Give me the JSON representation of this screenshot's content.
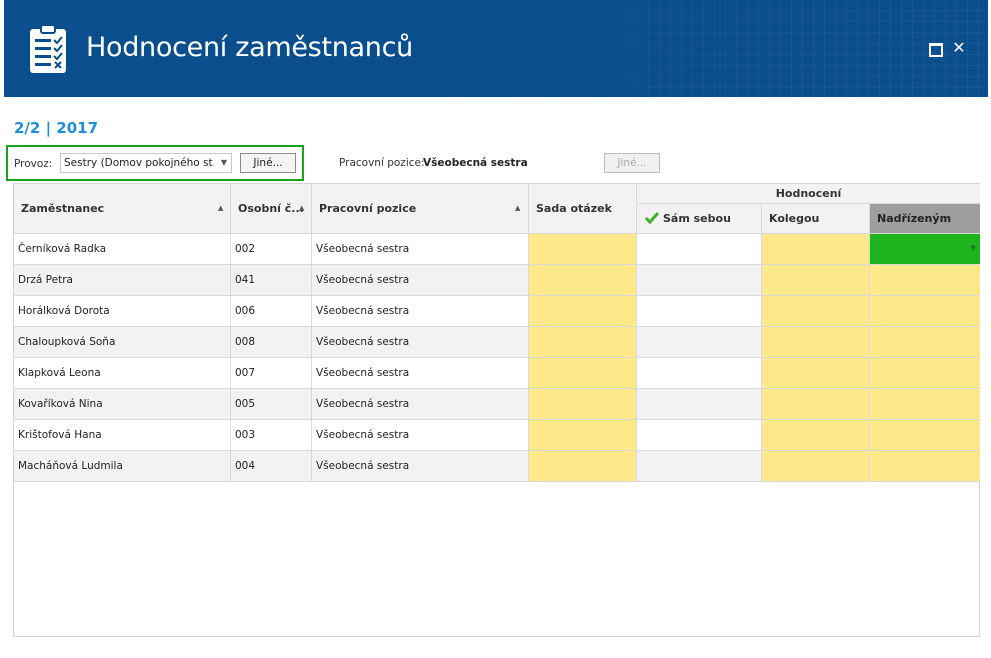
{
  "app": {
    "title": "Hodnocení zaměstnanců",
    "icon": "clipboard-checklist-icon"
  },
  "window_controls": {
    "maximize_icon": "maximize-icon",
    "close_icon": "close-icon",
    "close_glyph": "✕"
  },
  "period": "2/2 | 2017",
  "filters": {
    "provoz_label": "Provoz:",
    "provoz_value": "Sestry (Domov pokojného st...",
    "jine_label": "Jiné...",
    "position_label": "Pracovní pozice:",
    "position_value": "Všeobecná sestra",
    "jine2_label": "Jiné..."
  },
  "table": {
    "columns": {
      "employee": "Zaměstnanec",
      "personal_no": "Osobní č...",
      "position": "Pracovní pozice",
      "question_set": "Sada otázek",
      "evaluation_group": "Hodnocení",
      "self": "Sám sebou",
      "colleague": "Kolegou",
      "superior": "Nadřízeným"
    },
    "rows": [
      {
        "name": "Černíková Radka",
        "no": "002",
        "position": "Všeobecná sestra"
      },
      {
        "name": "Drzá Petra",
        "no": "041",
        "position": "Všeobecná sestra"
      },
      {
        "name": "Horálková Dorota",
        "no": "006",
        "position": "Všeobecná sestra"
      },
      {
        "name": "Chaloupková Soňa",
        "no": "008",
        "position": "Všeobecná sestra"
      },
      {
        "name": "Klapková Leona",
        "no": "007",
        "position": "Všeobecná sestra"
      },
      {
        "name": "Kovaříková Nina",
        "no": "005",
        "position": "Všeobecná sestra"
      },
      {
        "name": "Krištofová Hana",
        "no": "003",
        "position": "Všeobecná sestra"
      },
      {
        "name": "Macháňová Ludmila",
        "no": "004",
        "position": "Všeobecná sestra"
      }
    ]
  },
  "colors": {
    "banner": "#0b4e8d",
    "period_accent": "#1f8ed9",
    "highlight_border": "#1aa31a",
    "cell_yellow": "#ffe88a",
    "cell_green": "#1db41d",
    "active_header": "#9e9e9e"
  }
}
